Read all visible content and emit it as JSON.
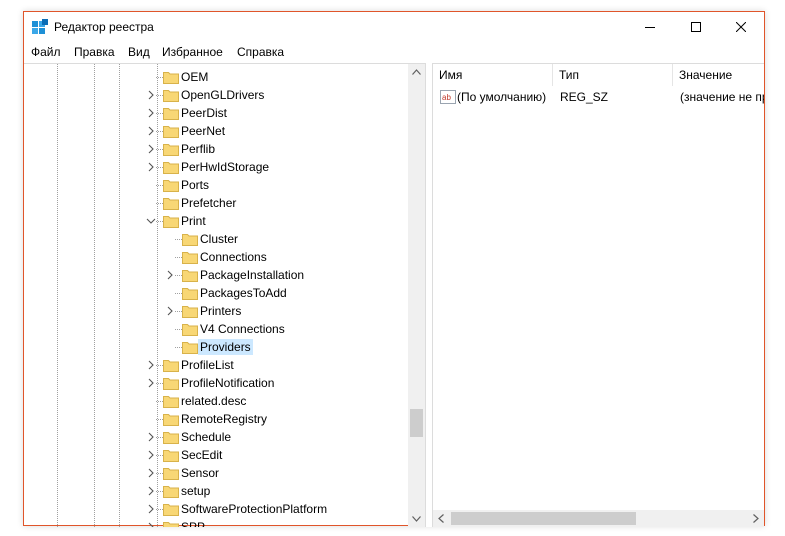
{
  "window": {
    "title": "Редактор реестра",
    "accent_border": "#e0552a"
  },
  "menu": [
    "Файл",
    "Правка",
    "Вид",
    "Избранное",
    "Справка"
  ],
  "tree": {
    "items": [
      {
        "label": "OEM",
        "level": 1,
        "expander": "none"
      },
      {
        "label": "OpenGLDrivers",
        "level": 1,
        "expander": "collapsed"
      },
      {
        "label": "PeerDist",
        "level": 1,
        "expander": "collapsed"
      },
      {
        "label": "PeerNet",
        "level": 1,
        "expander": "collapsed"
      },
      {
        "label": "Perflib",
        "level": 1,
        "expander": "collapsed"
      },
      {
        "label": "PerHwIdStorage",
        "level": 1,
        "expander": "collapsed"
      },
      {
        "label": "Ports",
        "level": 1,
        "expander": "none"
      },
      {
        "label": "Prefetcher",
        "level": 1,
        "expander": "none"
      },
      {
        "label": "Print",
        "level": 1,
        "expander": "expanded"
      },
      {
        "label": "Cluster",
        "level": 2,
        "expander": "none"
      },
      {
        "label": "Connections",
        "level": 2,
        "expander": "none"
      },
      {
        "label": "PackageInstallation",
        "level": 2,
        "expander": "collapsed"
      },
      {
        "label": "PackagesToAdd",
        "level": 2,
        "expander": "none"
      },
      {
        "label": "Printers",
        "level": 2,
        "expander": "collapsed"
      },
      {
        "label": "V4 Connections",
        "level": 2,
        "expander": "none"
      },
      {
        "label": "Providers",
        "level": 2,
        "expander": "none",
        "selected": true
      },
      {
        "label": "ProfileList",
        "level": 1,
        "expander": "collapsed"
      },
      {
        "label": "ProfileNotification",
        "level": 1,
        "expander": "collapsed"
      },
      {
        "label": "related.desc",
        "level": 1,
        "expander": "none"
      },
      {
        "label": "RemoteRegistry",
        "level": 1,
        "expander": "none"
      },
      {
        "label": "Schedule",
        "level": 1,
        "expander": "collapsed"
      },
      {
        "label": "SecEdit",
        "level": 1,
        "expander": "collapsed"
      },
      {
        "label": "Sensor",
        "level": 1,
        "expander": "collapsed"
      },
      {
        "label": "setup",
        "level": 1,
        "expander": "collapsed"
      },
      {
        "label": "SoftwareProtectionPlatform",
        "level": 1,
        "expander": "collapsed"
      },
      {
        "label": "SPP",
        "level": 1,
        "expander": "collapsed"
      }
    ]
  },
  "list": {
    "columns": [
      "Имя",
      "Тип",
      "Значение"
    ],
    "rows": [
      {
        "name": "(По умолчанию)",
        "type": "REG_SZ",
        "value": "(значение не пр"
      }
    ]
  }
}
